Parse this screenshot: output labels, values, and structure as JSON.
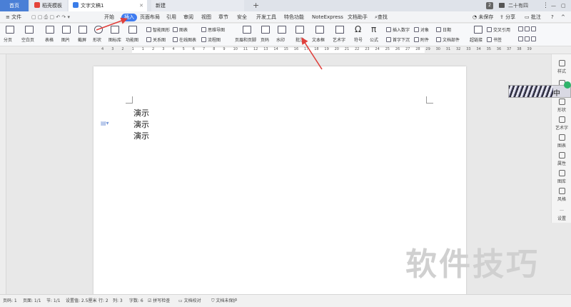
{
  "tabs": {
    "home": "首页",
    "template": "稻壳模板",
    "document": "文字文稿1",
    "new": "新建",
    "add": "+"
  },
  "titlebar": {
    "page_count": "2",
    "username": "二十有四",
    "more": "⋮"
  },
  "menu": {
    "file": "文件",
    "items": [
      "开始",
      "插入",
      "页面布局",
      "引用",
      "审阅",
      "视图",
      "章节",
      "安全",
      "开发工具",
      "特色功能",
      "NoteExpress",
      "文档助手"
    ],
    "search": "查找",
    "unsaved": "未保存",
    "share": "分享",
    "comment": "批注"
  },
  "ribbon": {
    "pagination": "分页",
    "blank_page": "空白页",
    "table": "表格",
    "picture": "图片",
    "screenshot": "截屏",
    "shape": "形状",
    "icon_lib": "图标库",
    "function_chart": "功能图",
    "smart_graphic": "智能图形",
    "chart": "图表",
    "mind_map": "思维导图",
    "relation": "关系图",
    "online_chart": "在线图表",
    "flow_chart": "流程图",
    "header_footer": "页眉和页脚",
    "page_number": "页码",
    "watermark": "水印",
    "comment": "批注",
    "text_box": "文本框",
    "art_text": "艺术字",
    "symbol": "符号",
    "formula": "公式",
    "insert_number": "插入数字",
    "drop_cap": "首字下沉",
    "object": "对象",
    "attachment": "附件",
    "date": "日期",
    "doc_parts": "文档部件",
    "hyperlink": "超链接",
    "cross_ref": "交叉引用",
    "bookmark": "书签"
  },
  "ruler_numbers": [
    "4",
    "3",
    "2",
    "1",
    "1",
    "2",
    "3",
    "4",
    "5",
    "6",
    "7",
    "8",
    "9",
    "10",
    "11",
    "12",
    "13",
    "14",
    "15",
    "16",
    "17",
    "18",
    "19",
    "20",
    "21",
    "22",
    "23",
    "24",
    "25",
    "26",
    "27",
    "28",
    "29",
    "30",
    "31",
    "32",
    "33",
    "34",
    "35",
    "36",
    "37",
    "38",
    "39"
  ],
  "document": {
    "lines": [
      "演示",
      "演示",
      "演示"
    ]
  },
  "side_panel": {
    "items": [
      "样式",
      "选择",
      "形状",
      "艺术字",
      "图表",
      "属性",
      "图库",
      "风格",
      "设置"
    ]
  },
  "overlay": {
    "ime_label": "中"
  },
  "status": {
    "page": "页码: 1",
    "pages": "页面: 1/1",
    "section": "节: 1/1",
    "setting": "设置值: 2.5厘米",
    "row": "行: 2",
    "col": "列: 3",
    "words": "字数: 6",
    "spell": "拼写检查",
    "proofread": "文档校对",
    "protect": "文档未保护"
  },
  "watermark_text": "软件技巧",
  "colors": {
    "accent": "#3f7cf0",
    "arrow": "#e0403c"
  }
}
